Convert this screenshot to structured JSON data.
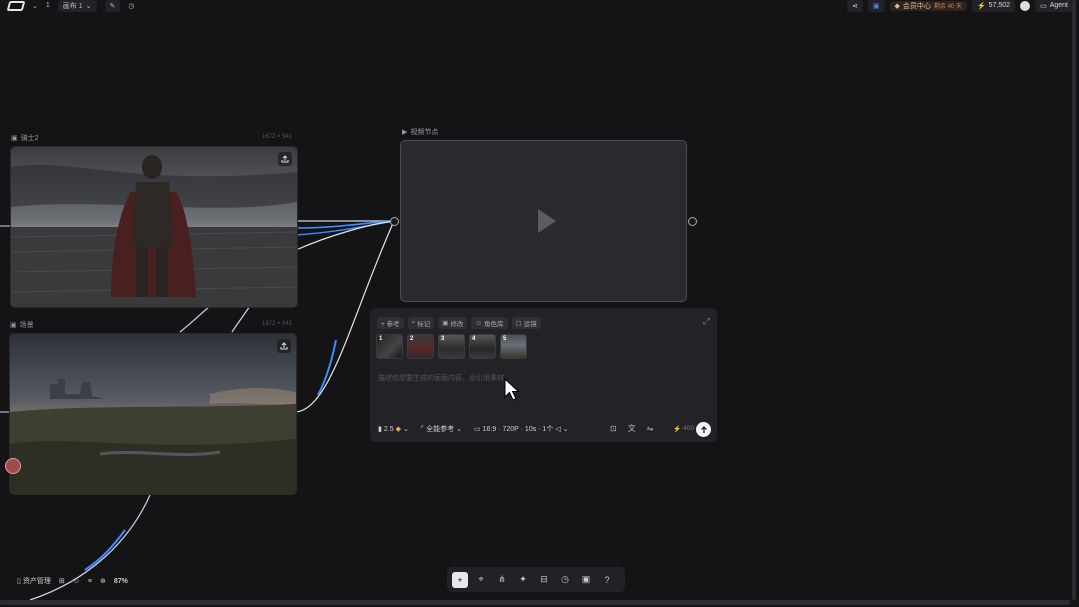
{
  "topbar": {
    "project_number": "1",
    "canvas_label": "画布 1",
    "member_center_label": "会员中心",
    "member_badge": "剩余 40 天",
    "credits": "57,502",
    "agent_label": "Agent"
  },
  "nodes": {
    "knight": {
      "title": "骑士2",
      "size": "1672 × 941"
    },
    "scene": {
      "title": "场景",
      "size": "1672 × 941"
    },
    "video": {
      "title": "视频节点"
    }
  },
  "prompt_panel": {
    "chips": [
      "+ 参考",
      "标记",
      "修改",
      "角色库",
      "运镜"
    ],
    "thumbs": [
      "1",
      "2",
      "3",
      "4",
      "5"
    ],
    "placeholder": "描述你想要生成的画面内容，@引用素材",
    "model": "2.5",
    "reference_mode": "全能参考",
    "settings": "16:9 · 720P · 10s · 1个",
    "cost": "400"
  },
  "bottom": {
    "assets_label": "资产管理",
    "zoom": "87%"
  },
  "colors": {
    "accent_blue": "#3d8bff",
    "background": "#141416"
  }
}
